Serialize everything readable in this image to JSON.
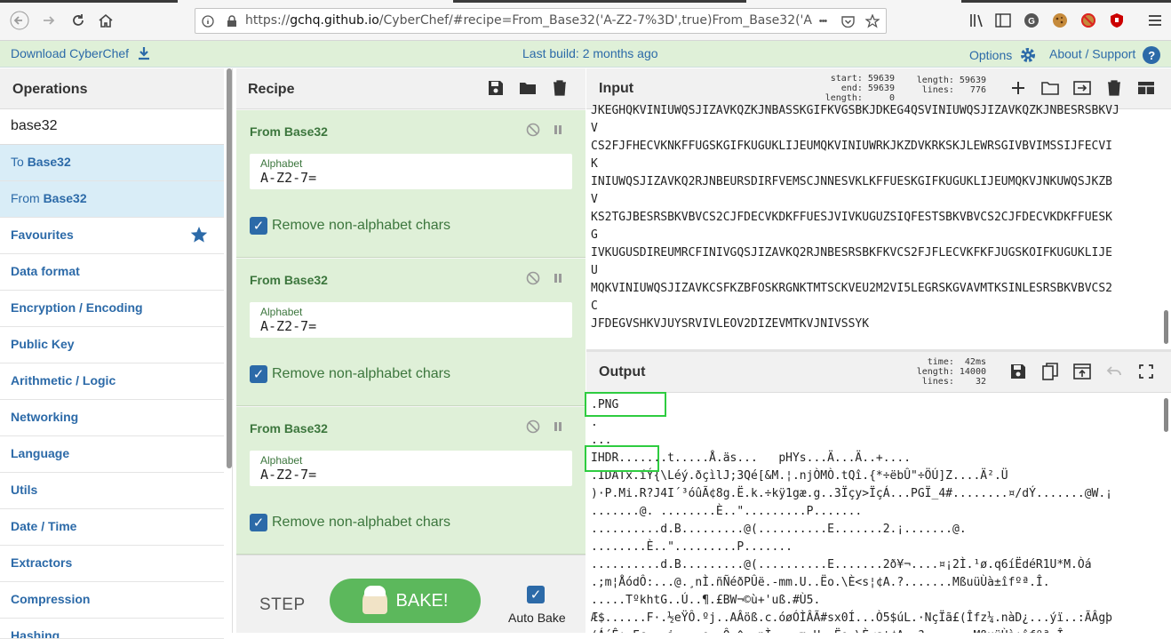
{
  "browser": {
    "url_prefix": "https://",
    "url_host": "gchq.github.io",
    "url_rest": "/CyberChef/#recipe=From_Base32('A-Z2-7%3D',true)From_Base32('A",
    "back_icon": "back-arrow-icon",
    "forward_icon": "forward-arrow-icon",
    "reload_icon": "reload-icon",
    "home_icon": "home-icon",
    "more_glyph": "•••"
  },
  "banner": {
    "download_label": "Download CyberChef",
    "build_label": "Last build: 2 months ago",
    "options_label": "Options",
    "about_label": "About / Support",
    "about_glyph": "?"
  },
  "operations": {
    "title": "Operations",
    "search_value": "base32",
    "results": [
      {
        "prefix": "To ",
        "match": "Base32"
      },
      {
        "prefix": "From ",
        "match": "Base32"
      }
    ],
    "categories": [
      "Favourites",
      "Data format",
      "Encryption / Encoding",
      "Public Key",
      "Arithmetic / Logic",
      "Networking",
      "Language",
      "Utils",
      "Date / Time",
      "Extractors",
      "Compression",
      "Hashing"
    ]
  },
  "recipe": {
    "title": "Recipe",
    "ops": [
      {
        "name": "From Base32",
        "alphabet_label": "Alphabet",
        "alphabet": "A-Z2-7=",
        "checkbox_label": "Remove non-alphabet chars",
        "checked": true
      },
      {
        "name": "From Base32",
        "alphabet_label": "Alphabet",
        "alphabet": "A-Z2-7=",
        "checkbox_label": "Remove non-alphabet chars",
        "checked": true
      },
      {
        "name": "From Base32",
        "alphabet_label": "Alphabet",
        "alphabet": "A-Z2-7=",
        "checkbox_label": "Remove non-alphabet chars",
        "checked": true
      }
    ],
    "step_label": "STEP",
    "bake_label": "BAKE!",
    "auto_bake_label": "Auto Bake",
    "auto_bake_checked": true
  },
  "input": {
    "title": "Input",
    "start": "start: 59639",
    "end": "end: 59639",
    "length_sel": "length:     0",
    "length": "length: 59639",
    "lines": "lines:   776",
    "text": "JKEGHQKVINIUWQSJIZAVKQZKJNBASSKGIFKVGSBKJDKEG4QSVINIUWQSJIZAVKQZKJNBESRSBKVJ\nV\nCS2FJFHECVKNKFFUGSKGIFKUGUKLIJEUMQKVINIUWRKJKZDVKRKSKJLEWRSGIVBVIMSSIJFECVI\nK\nINIUWQSJIZAVKQ2RJNBEURSDIRFVEMSCJNNESVKLKFFUESKGIFKUGUKLIJEUMQKVJNKUWQSJKZB\nV\nKS2TGJBESRSBKVBVCS2CJFDECVKDKFFUESJVIVKUGUZSIQFESTSBKVBVCS2CJFDECVKDKFFUESK\nG\nIVKUGUSDIREUMRCFINIVGQSJIZAVKQ2RJNBESRSBKFKVCS2FJFLECVKFKFJUGSKOIFKUGUKLIJE\nU\nMQKVINIUWQSJIZAVKCSFKZBFOSKRGNKTMTSCKVEU2M2VI5LEGRSKGVAVMTKSINLESRSBKVBVCS2\nC\nJFDEGVSHKVJUYSRVIVLEOV2DIZEVMTKVJNIVSSYK"
  },
  "output": {
    "title": "Output",
    "time": "time:  42ms",
    "length": "length: 14000",
    "lines": "lines:    32",
    "text": ".PNG\n.\n...\nIHDR.......t.....Å.äs...   pHYs...Ä...Ä..+....\n.IDATx.íÝ{\\Léý.ðçìlJ;3Qé[&M.¦.njÒMÒ.tQî.{*÷ëbÛ\"÷ÖÚ]Z....Ä².Ü\n)·P.Mi.R?J4I´³óûÃ¢8g.Ë.k.÷kÿ1gæ.g..3Ïçy>ÏçÁ...PGÏ_4#........¤/dÝ.......@W.¡\n.......@. ........È..\".........P.......\n..........d.B.........@(..........E.......2.¡.......@.\n........È..\".........P.......\n..........d.B.........@(..........E.......2ð¥¬....¤¡2Ì.¹ø.q6íËdéR1U*M.Òá\n.;m¦ÅódÔ:...@.¸nÌ.ñÑéðPÛë.-mm.U..Ëo.\\È<s¦¢A.?.......MßuüÙà±îfºª.Î.\n.....TºkhtG..Ú..¶.£BW¬©ù+'uß.#Ù5.\nÆ$......F·.½eŸÔ.ºj..AÂöß.c.óøÓÌÂÃ#sx0Í...Ò5$úL.·NçÏã£(Îfz¼.nàD¿...ýï..:ÃÂgþ\n(Á´Ê±.Fc...i....e..Ô.^.¸nÌ....m.U..Ëo.\\È<s¦¢A..?.......MßuüÙà±îfºª.Î.."
  }
}
